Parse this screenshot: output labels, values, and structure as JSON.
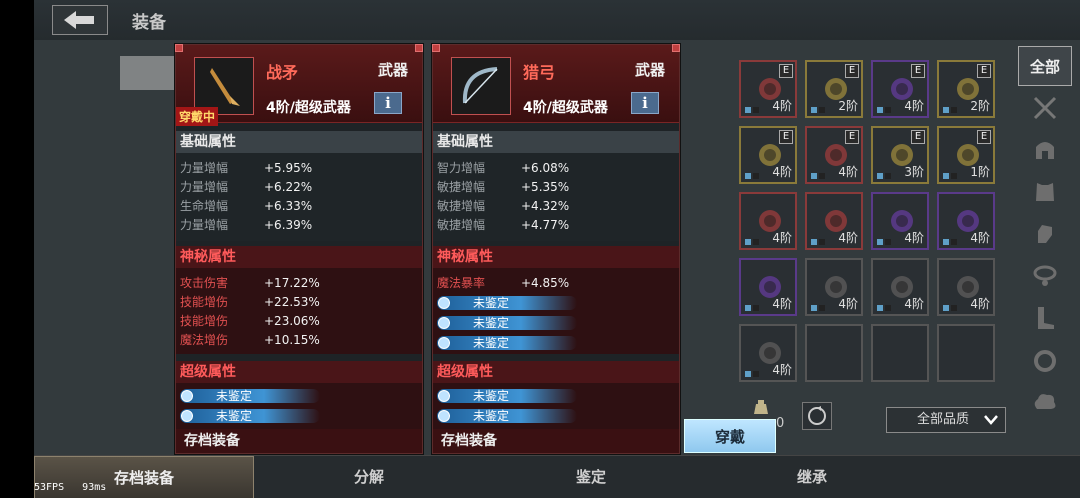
{
  "header": {
    "title": "装备"
  },
  "cards": [
    {
      "name": "战矛",
      "type": "武器",
      "tier": "4阶/超级武器",
      "badge": "穿戴中",
      "base_title": "基础属性",
      "base": [
        {
          "k": "力量增幅",
          "v": "+5.95%"
        },
        {
          "k": "力量增幅",
          "v": "+6.22%"
        },
        {
          "k": "生命增幅",
          "v": "+6.33%"
        },
        {
          "k": "力量增幅",
          "v": "+6.39%"
        }
      ],
      "myst_title": "神秘属性",
      "myst": [
        {
          "k": "攻击伤害",
          "v": "+17.22%"
        },
        {
          "k": "技能增伤",
          "v": "+22.53%"
        },
        {
          "k": "技能增伤",
          "v": "+23.06%"
        },
        {
          "k": "魔法增伤",
          "v": "+10.15%"
        }
      ],
      "super_title": "超级属性",
      "super": [
        "未鉴定",
        "未鉴定"
      ],
      "footer": "存档装备"
    },
    {
      "name": "猎弓",
      "type": "武器",
      "tier": "4阶/超级武器",
      "base_title": "基础属性",
      "base": [
        {
          "k": "智力增幅",
          "v": "+6.08%"
        },
        {
          "k": "敏捷增幅",
          "v": "+5.35%"
        },
        {
          "k": "敏捷增幅",
          "v": "+4.32%"
        },
        {
          "k": "敏捷增幅",
          "v": "+4.77%"
        }
      ],
      "myst_title": "神秘属性",
      "myst": [
        {
          "k": "魔法暴率",
          "v": "+4.85%"
        }
      ],
      "myst_unid": [
        "未鉴定",
        "未鉴定",
        "未鉴定"
      ],
      "super_title": "超级属性",
      "super": [
        "未鉴定",
        "未鉴定"
      ],
      "footer": "存档装备"
    }
  ],
  "info_label": "i",
  "grid": [
    {
      "tier": "4阶",
      "e": "E",
      "color": "#8a3a3a"
    },
    {
      "tier": "2阶",
      "e": "E",
      "color": "#8a7a3a"
    },
    {
      "tier": "4阶",
      "e": "E",
      "color": "#5a3a8a"
    },
    {
      "tier": "2阶",
      "e": "E",
      "color": "#8a7a3a"
    },
    {
      "tier": "4阶",
      "e": "E",
      "color": "#8a7a3a"
    },
    {
      "tier": "4阶",
      "e": "E",
      "color": "#8a3a3a"
    },
    {
      "tier": "3阶",
      "e": "E",
      "color": "#8a7a3a"
    },
    {
      "tier": "1阶",
      "e": "E",
      "color": "#8a7a3a"
    },
    {
      "tier": "4阶",
      "color": "#8a3a3a"
    },
    {
      "tier": "4阶",
      "color": "#8a3a3a"
    },
    {
      "tier": "4阶",
      "color": "#5a3a8a"
    },
    {
      "tier": "4阶",
      "color": "#5a3a8a"
    },
    {
      "tier": "4阶",
      "color": "#5a3a8a"
    },
    {
      "tier": "4阶",
      "color": "#555"
    },
    {
      "tier": "4阶",
      "color": "#555"
    },
    {
      "tier": "4阶",
      "color": "#555"
    },
    {
      "tier": "4阶",
      "color": "#555"
    },
    {
      "tier": "",
      "color": "#555"
    },
    {
      "tier": "",
      "color": "#555"
    },
    {
      "tier": "",
      "color": "#555"
    }
  ],
  "sidebar": {
    "all_label": "全部"
  },
  "quality_select": "全部品质",
  "wear_button": "穿戴",
  "bottom_tabs": [
    "存档装备",
    "分解",
    "鉴定",
    "继承"
  ],
  "fps": "53FPS",
  "latency": "93ms",
  "count_label": "0"
}
